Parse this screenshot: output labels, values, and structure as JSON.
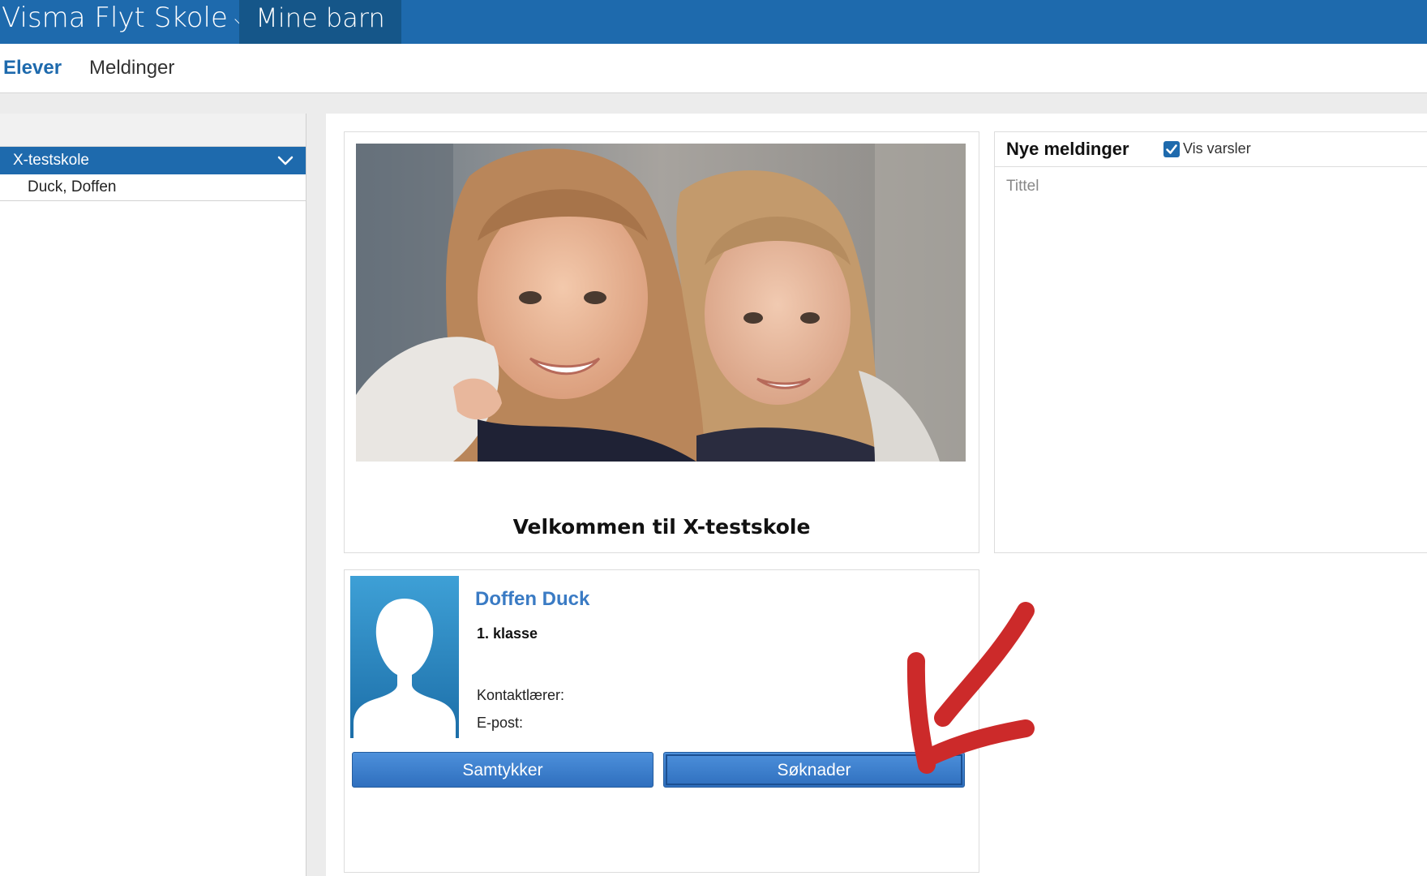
{
  "topbar": {
    "brand": "Visma Flyt Skole",
    "brand_caret": "⌵",
    "module": "Mine barn",
    "color": "#1e6aad"
  },
  "subnav": {
    "items": [
      {
        "label": "Elever",
        "active": true
      },
      {
        "label": "Meldinger",
        "active": false
      }
    ]
  },
  "sidebar": {
    "school": "X-testskole",
    "students": [
      "Duck, Doffen"
    ]
  },
  "welcome": {
    "title": "Velkommen til X-testskole"
  },
  "messages": {
    "title": "Nye meldinger",
    "show_alerts_label": "Vis varsler",
    "show_alerts_checked": true,
    "column_title": "Tittel"
  },
  "student": {
    "name": "Doffen Duck",
    "class": "1. klasse",
    "contact_teacher_label": "Kontaktlærer:",
    "email_label": "E-post:",
    "buttons": {
      "consents": "Samtykker",
      "applications": "Søknader"
    }
  },
  "icons": {
    "school_toggle": "chevron-down-icon",
    "avatar": "person-silhouette-icon",
    "checkbox": "check-icon",
    "annotation": "red-arrow-annotation"
  }
}
